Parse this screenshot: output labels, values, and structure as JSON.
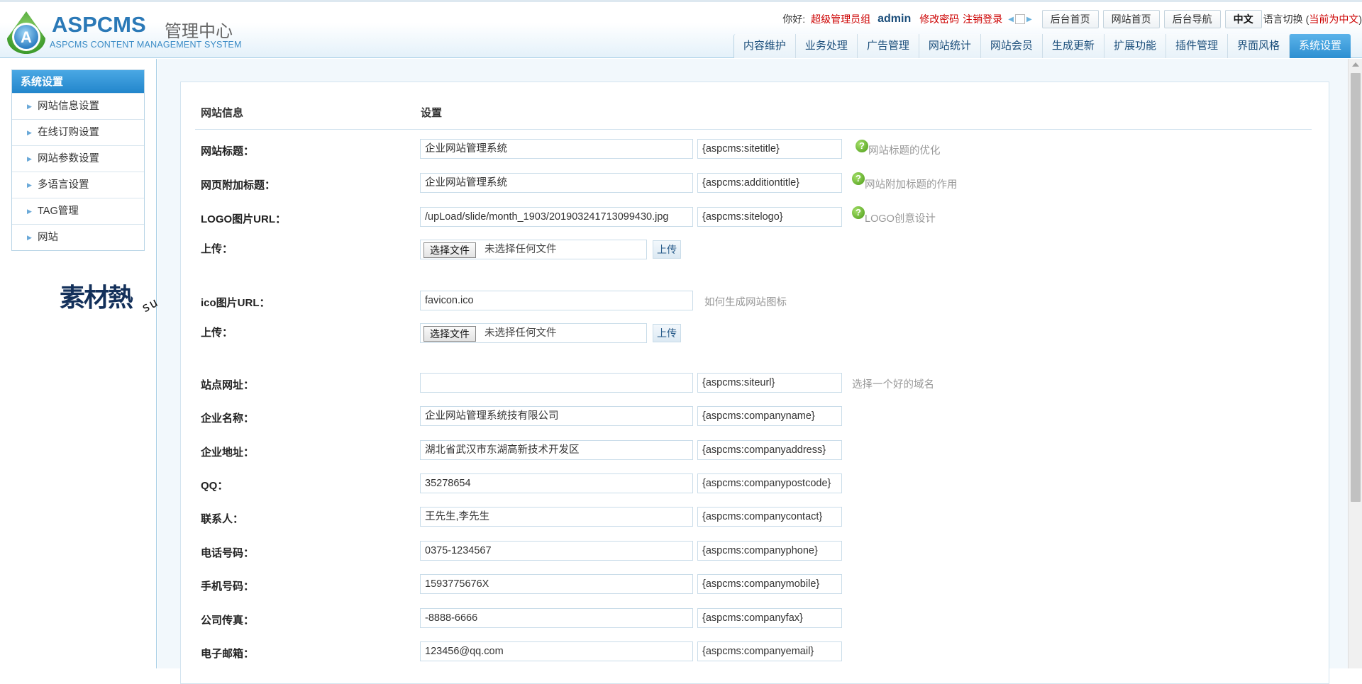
{
  "header": {
    "logo_name": "ASPCMS",
    "logo_cn": "管理中心",
    "logo_en": "ASPCMS CONTENT MANAGEMENT SYSTEM",
    "greeting": "你好:",
    "role": "超级管理员组",
    "username": "admin",
    "change_password": "修改密码",
    "logout": "注销登录",
    "buttons": [
      "后台首页",
      "网站首页",
      "后台导航",
      "中文"
    ],
    "lang_switch": "语言切换",
    "lang_paren_open": "(",
    "lang_current": "当前为中文",
    "lang_paren_close": ")"
  },
  "nav": {
    "tabs": [
      "内容维护",
      "业务处理",
      "广告管理",
      "网站统计",
      "网站会员",
      "生成更新",
      "扩展功能",
      "插件管理",
      "界面风格",
      "系统设置"
    ],
    "active_index": 9
  },
  "sidebar": {
    "title": "系统设置",
    "items": [
      "网站信息设置",
      "在线订购设置",
      "网站参数设置",
      "多语言设置",
      "TAG管理",
      "网站"
    ]
  },
  "watermark": {
    "cn": "素材熱",
    "en": "sucaire.com"
  },
  "form": {
    "header_left": "网站信息",
    "header_right": "设置",
    "rows": [
      {
        "label": "网站标题：",
        "value": "企业网站管理系统",
        "tag": "{aspcms:sitetitle}",
        "hint": "网站标题的优化"
      },
      {
        "label": "网页附加标题：",
        "value": "企业网站管理系统",
        "tag": "{aspcms:additiontitle}",
        "hint": "网站附加标题的作用"
      },
      {
        "label": "LOGO图片URL：",
        "value": "/upLoad/slide/month_1903/201903241713099430.jpg",
        "tag": "{aspcms:sitelogo}",
        "hint": "LOGO创意设计"
      },
      {
        "label": "ico图片URL：",
        "value": "favicon.ico",
        "hint": "如何生成网站图标"
      },
      {
        "label": "站点网址：",
        "value": "",
        "tag": "{aspcms:siteurl}",
        "hint": "选择一个好的域名"
      },
      {
        "label": "企业名称：",
        "value": "企业网站管理系统技有限公司",
        "tag": "{aspcms:companyname}"
      },
      {
        "label": "企业地址：",
        "value": "湖北省武汉市东湖高新技术开发区",
        "tag": "{aspcms:companyaddress}"
      },
      {
        "label": "QQ：",
        "value": "35278654",
        "tag": "{aspcms:companypostcode}"
      },
      {
        "label": "联系人：",
        "value": "王先生,李先生",
        "tag": "{aspcms:companycontact}"
      },
      {
        "label": "电话号码：",
        "value": "0375-1234567",
        "tag": "{aspcms:companyphone}"
      },
      {
        "label": "手机号码：",
        "value": "1593775676X",
        "tag": "{aspcms:companymobile}"
      },
      {
        "label": "公司传真：",
        "value": "-8888-6666",
        "tag": "{aspcms:companyfax}"
      },
      {
        "label": "电子邮箱：",
        "value": "123456@qq.com",
        "tag": "{aspcms:companyemail}"
      }
    ],
    "upload_label": "上传：",
    "file_button": "选择文件",
    "file_none": "未选择任何文件",
    "upload_button": "上传"
  },
  "colors": {
    "accent": "#2d8fd1",
    "warning_red": "#cc0000",
    "hint_gray": "#999999"
  }
}
